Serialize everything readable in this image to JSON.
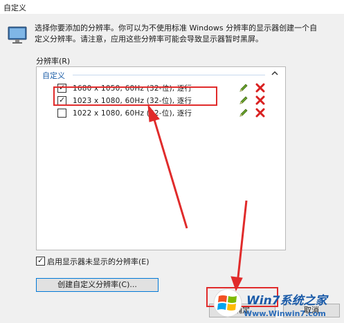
{
  "window": {
    "title": "自定义"
  },
  "intro": {
    "line1": "选择你要添加的分辨率。你可以为不使用标准 Windows 分辨率的显示器创建一个自",
    "line2": "定义分辨率。请注意，应用这些分辨率可能会导致显示器暂时黑屏。"
  },
  "resolution": {
    "label": "分辨率(R)",
    "group_header": "自定义",
    "items": [
      {
        "text": "1680 x 1050, 60Hz (32-位), 逐行",
        "checked": true
      },
      {
        "text": "1023 x 1080, 60Hz (32-位), 逐行",
        "checked": true
      },
      {
        "text": "1022 x 1080, 60Hz (32-位), 逐行",
        "checked": false
      }
    ]
  },
  "show_hidden": {
    "label": "启用显示器未显示的分辨率(E)",
    "checked": true
  },
  "buttons": {
    "create": "创建自定义分辨率(C)...",
    "ok": "确定",
    "cancel": "取消"
  },
  "watermark": {
    "brand": "Win7系统之家",
    "url": "Www.Winwin7.com"
  },
  "colors": {
    "accent": "#1e5fa8",
    "annotation_red": "#e02b2b",
    "delete_red": "#d92020",
    "edit_green": "#6aa12c"
  },
  "icons": {
    "monitor": "monitor-icon",
    "edit": "pencil-icon",
    "delete": "x-icon",
    "collapse": "chevron-up-icon"
  }
}
